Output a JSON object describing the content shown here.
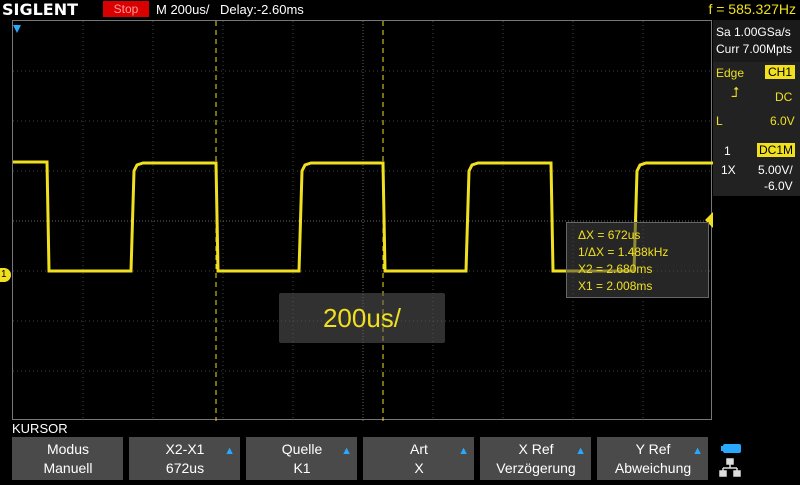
{
  "header": {
    "brand": "SIGLENT",
    "status": "Stop",
    "timebase": "M 200us/",
    "delay": "Delay:-2.60ms",
    "frequency": "f = 585.327Hz"
  },
  "acquisition": {
    "sample_rate": "Sa 1.00GSa/s",
    "memory": "Curr 7.00Mpts"
  },
  "trigger": {
    "type": "Edge",
    "source": "CH1",
    "coupling": "DC",
    "level_label": "L",
    "level": "6.0V"
  },
  "channel": {
    "number": "1",
    "coupling": "DC1M",
    "probe": "1X",
    "scale": "5.00V/",
    "offset": "-6.0V"
  },
  "cursor_readout": {
    "dx": "ΔX = 672us",
    "inv_dx": "1/ΔX = 1.488kHz",
    "x2": "X2 = 2.680ms",
    "x1": "X1 = 2.008ms"
  },
  "timebase_popup": "200us/",
  "menu": {
    "title": "KURSOR",
    "softkeys": [
      {
        "line1": "Modus",
        "line2": "Manuell",
        "arrow": false
      },
      {
        "line1": "X2-X1",
        "line2": "672us",
        "arrow": true
      },
      {
        "line1": "Quelle",
        "line2": "K1",
        "arrow": true
      },
      {
        "line1": "Art",
        "line2": "X",
        "arrow": true
      },
      {
        "line1": "X Ref",
        "line2": "Verzögerung",
        "arrow": true
      },
      {
        "line1": "Y Ref",
        "line2": "Abweichung",
        "arrow": true
      }
    ]
  },
  "colors": {
    "trace": "#f0e020",
    "cursor": "#f0e020",
    "status_stop": "#d80000",
    "softkey_bg": "#4a4a4a",
    "accent_blue": "#29a8ff"
  }
}
